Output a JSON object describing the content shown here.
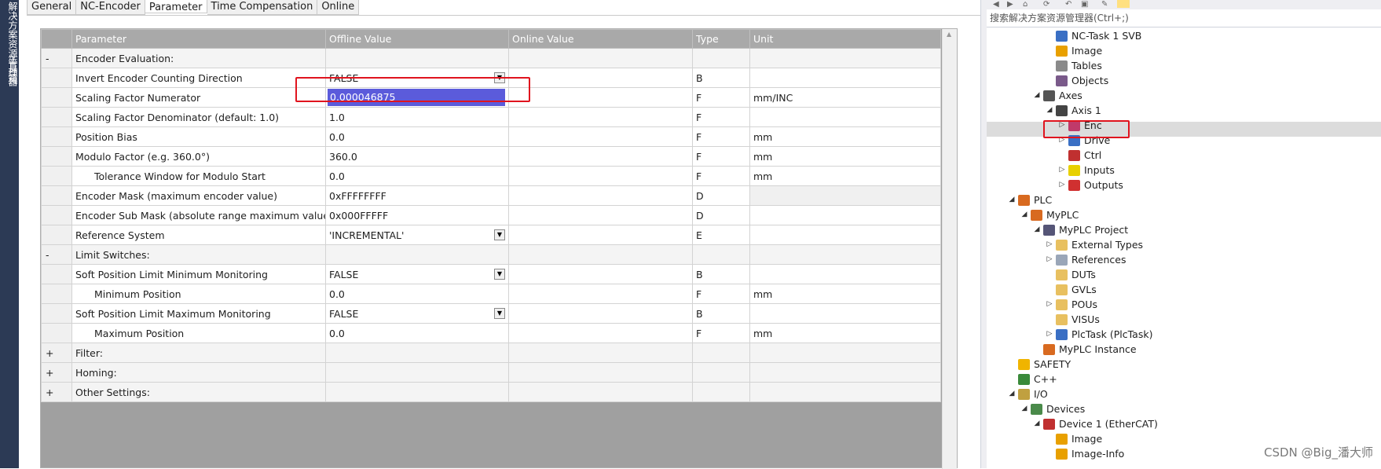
{
  "side_tabs": [
    "解决方案资源管理器",
    "工具箱"
  ],
  "tabs": [
    "General",
    "NC-Encoder",
    "Parameter",
    "Time Compensation",
    "Online"
  ],
  "active_tab": "Parameter",
  "columns": [
    "Parameter",
    "Offline Value",
    "Online Value",
    "Type",
    "Unit"
  ],
  "rows": [
    {
      "kind": "group",
      "toggle": "-",
      "name": "Encoder Evaluation:"
    },
    {
      "kind": "param",
      "name": "Invert Encoder Counting Direction",
      "offline": "FALSE",
      "online": "",
      "type": "B",
      "unit": "",
      "dropdown": true
    },
    {
      "kind": "param",
      "name": "Scaling Factor Numerator",
      "offline": "0.000046875",
      "online": "",
      "type": "F",
      "unit": "mm/INC",
      "editing": true
    },
    {
      "kind": "param",
      "name": "Scaling Factor Denominator (default: 1.0)",
      "offline": "1.0",
      "online": "",
      "type": "F",
      "unit": ""
    },
    {
      "kind": "param",
      "name": "Position Bias",
      "offline": "0.0",
      "online": "",
      "type": "F",
      "unit": "mm"
    },
    {
      "kind": "param",
      "name": "Modulo Factor (e.g. 360.0°)",
      "offline": "360.0",
      "online": "",
      "type": "F",
      "unit": "mm"
    },
    {
      "kind": "param",
      "name": "Tolerance Window for Modulo Start",
      "offline": "0.0",
      "online": "",
      "type": "F",
      "unit": "mm",
      "indent": true
    },
    {
      "kind": "param",
      "name": "Encoder Mask (maximum encoder value)",
      "offline": "0xFFFFFFFF",
      "online": "",
      "type": "D",
      "unit": "",
      "shaded_unit": true
    },
    {
      "kind": "param",
      "name": "Encoder Sub Mask (absolute range maximum value)",
      "offline": "0x000FFFFF",
      "online": "",
      "type": "D",
      "unit": ""
    },
    {
      "kind": "param",
      "name": "Reference System",
      "offline": "'INCREMENTAL'",
      "online": "",
      "type": "E",
      "unit": "",
      "dropdown": true
    },
    {
      "kind": "group",
      "toggle": "-",
      "name": "Limit Switches:"
    },
    {
      "kind": "param",
      "name": "Soft Position Limit Minimum Monitoring",
      "offline": "FALSE",
      "online": "",
      "type": "B",
      "unit": "",
      "dropdown": true
    },
    {
      "kind": "param",
      "name": "Minimum Position",
      "offline": "0.0",
      "online": "",
      "type": "F",
      "unit": "mm",
      "indent": true
    },
    {
      "kind": "param",
      "name": "Soft Position Limit Maximum Monitoring",
      "offline": "FALSE",
      "online": "",
      "type": "B",
      "unit": "",
      "dropdown": true
    },
    {
      "kind": "param",
      "name": "Maximum Position",
      "offline": "0.0",
      "online": "",
      "type": "F",
      "unit": "mm",
      "indent": true
    },
    {
      "kind": "group",
      "toggle": "+",
      "name": "Filter:"
    },
    {
      "kind": "group",
      "toggle": "+",
      "name": "Homing:"
    },
    {
      "kind": "group",
      "toggle": "+",
      "name": "Other Settings:"
    }
  ],
  "solution_search_placeholder": "搜索解决方案资源管理器(Ctrl+;)",
  "tree": [
    {
      "label": "NC-Task 1 SVB",
      "level": 5,
      "arrow": "",
      "icon": "task-icon",
      "color": "#3a6fc4"
    },
    {
      "label": "Image",
      "level": 5,
      "arrow": "",
      "icon": "image-icon",
      "color": "#e8a000"
    },
    {
      "label": "Tables",
      "level": 5,
      "arrow": "",
      "icon": "tables-icon",
      "color": "#8a8a8a"
    },
    {
      "label": "Objects",
      "level": 5,
      "arrow": "",
      "icon": "objects-icon",
      "color": "#7a5a8a"
    },
    {
      "label": "Axes",
      "level": 4,
      "arrow": "◢",
      "icon": "axes-icon",
      "color": "#555555"
    },
    {
      "label": "Axis 1",
      "level": 5,
      "arrow": "◢",
      "icon": "axis-icon",
      "color": "#444444"
    },
    {
      "label": "Enc",
      "level": 6,
      "arrow": "▷",
      "icon": "encoder-icon",
      "color": "#c03a6a",
      "selected": true
    },
    {
      "label": "Drive",
      "level": 6,
      "arrow": "▷",
      "icon": "drive-icon",
      "color": "#3a6fc4"
    },
    {
      "label": "Ctrl",
      "level": 6,
      "arrow": "",
      "icon": "ctrl-icon",
      "color": "#c03030"
    },
    {
      "label": "Inputs",
      "level": 6,
      "arrow": "▷",
      "icon": "inputs-icon",
      "color": "#e8d000"
    },
    {
      "label": "Outputs",
      "level": 6,
      "arrow": "▷",
      "icon": "outputs-icon",
      "color": "#d03030"
    },
    {
      "label": "PLC",
      "level": 2,
      "arrow": "◢",
      "icon": "plc-icon",
      "color": "#d86a20"
    },
    {
      "label": "MyPLC",
      "level": 3,
      "arrow": "◢",
      "icon": "myplc-icon",
      "color": "#d86a20"
    },
    {
      "label": "MyPLC Project",
      "level": 4,
      "arrow": "◢",
      "icon": "project-icon",
      "color": "#555577"
    },
    {
      "label": "External Types",
      "level": 5,
      "arrow": "▷",
      "icon": "folder-icon",
      "color": "#e8c060"
    },
    {
      "label": "References",
      "level": 5,
      "arrow": "▷",
      "icon": "references-icon",
      "color": "#9aa6b8"
    },
    {
      "label": "DUTs",
      "level": 5,
      "arrow": "",
      "icon": "folder-icon",
      "color": "#e8c060"
    },
    {
      "label": "GVLs",
      "level": 5,
      "arrow": "",
      "icon": "folder-icon",
      "color": "#e8c060"
    },
    {
      "label": "POUs",
      "level": 5,
      "arrow": "▷",
      "icon": "folder-icon",
      "color": "#e8c060"
    },
    {
      "label": "VISUs",
      "level": 5,
      "arrow": "",
      "icon": "folder-icon",
      "color": "#e8c060"
    },
    {
      "label": "PlcTask (PlcTask)",
      "level": 5,
      "arrow": "▷",
      "icon": "plctask-icon",
      "color": "#3a6fc4"
    },
    {
      "label": "MyPLC Instance",
      "level": 4,
      "arrow": "",
      "icon": "instance-icon",
      "color": "#d86a20"
    },
    {
      "label": "SAFETY",
      "level": 2,
      "arrow": "",
      "icon": "safety-icon",
      "color": "#f0b400"
    },
    {
      "label": "C++",
      "level": 2,
      "arrow": "",
      "icon": "cpp-icon",
      "color": "#3a8a3a"
    },
    {
      "label": "I/O",
      "level": 2,
      "arrow": "◢",
      "icon": "io-icon",
      "color": "#c0a040"
    },
    {
      "label": "Devices",
      "level": 3,
      "arrow": "◢",
      "icon": "devices-icon",
      "color": "#4a8a4a"
    },
    {
      "label": "Device 1 (EtherCAT)",
      "level": 4,
      "arrow": "◢",
      "icon": "ethercat-icon",
      "color": "#c03030"
    },
    {
      "label": "Image",
      "level": 5,
      "arrow": "",
      "icon": "image-icon",
      "color": "#e8a000"
    },
    {
      "label": "Image-Info",
      "level": 5,
      "arrow": "",
      "icon": "image-icon",
      "color": "#e8a000"
    }
  ],
  "watermark": "CSDN @Big_潘大师"
}
